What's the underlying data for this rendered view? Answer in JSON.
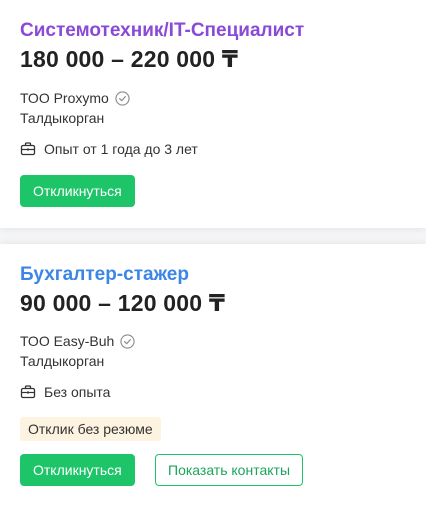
{
  "vacancies": [
    {
      "title": "Системотехник/IT-Специалист",
      "salary": "180 000 – 220 000 ₸",
      "company": "ТОО Proxymo",
      "city": "Талдыкорган",
      "experience": "Опыт от 1 года до 3 лет",
      "apply_label": "Откликнуться",
      "title_color": "#8a4ad8"
    },
    {
      "title": "Бухгалтер-стажер",
      "salary": "90 000 – 120 000 ₸",
      "company": "ТОО Easy-Buh",
      "city": "Талдыкорган",
      "experience": "Без опыта",
      "badge": "Отклик без резюме",
      "apply_label": "Откликнуться",
      "contacts_label": "Показать контакты",
      "title_color": "#3b86e6"
    }
  ],
  "icons": {
    "verified": "verified-check-icon",
    "experience": "briefcase-icon"
  },
  "colors": {
    "accent_green": "#1ec468",
    "badge_bg": "#fdf3e1"
  }
}
